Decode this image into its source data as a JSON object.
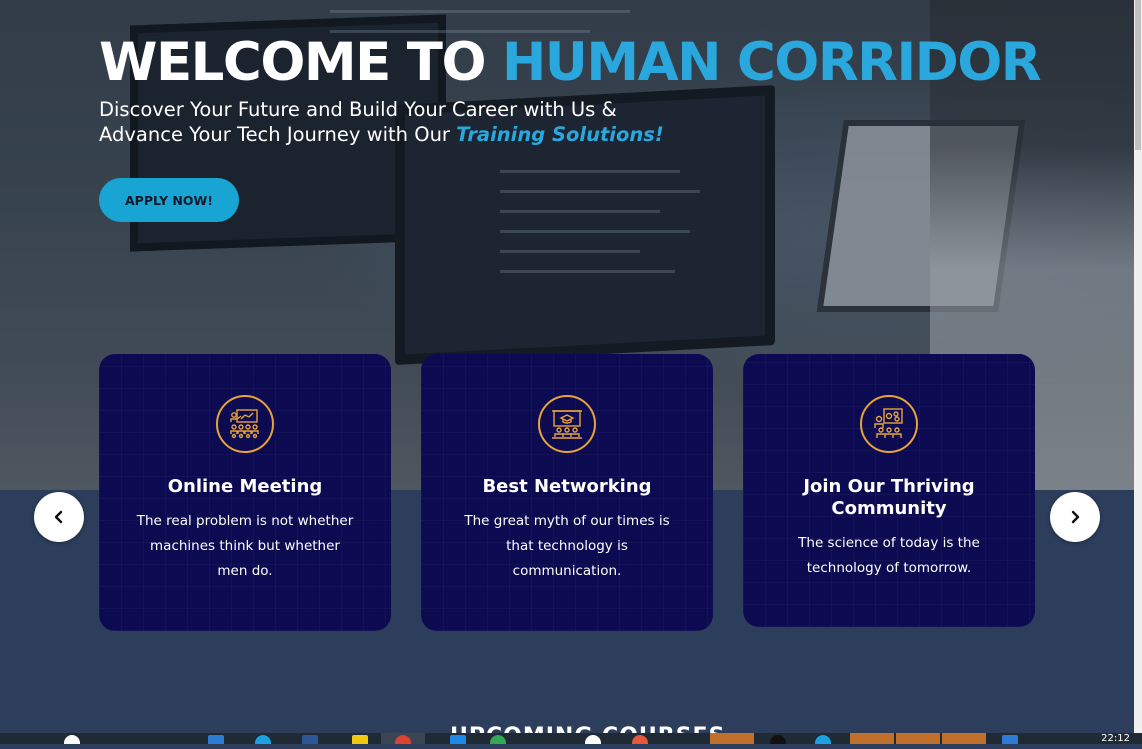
{
  "hero": {
    "title_main": "WELCOME TO ",
    "title_accent": "HUMAN CORRIDOR",
    "subtitle_line1": "Discover Your Future and Build Your Career with Us &",
    "subtitle_line2": "Advance Your Tech Journey with Our ",
    "subtitle_emphasis": "Training Solutions!",
    "apply_label": "APPLY NOW!"
  },
  "cards": [
    {
      "icon": "online-meeting-icon",
      "title": "Online Meeting",
      "text": "The real problem is not whether machines think but whether men do."
    },
    {
      "icon": "networking-presentation-icon",
      "title": "Best Networking",
      "text": "The great myth of our times is that technology is communication."
    },
    {
      "icon": "community-icon",
      "title": "Join Our Thriving Community",
      "text": "The science of today is the technology of tomorrow."
    }
  ],
  "carousel": {
    "prev_icon": "chevron-left-icon",
    "next_icon": "chevron-right-icon"
  },
  "next_section_title": "UPCOMING COURSES",
  "taskbar": {
    "clock": "22:12"
  },
  "colors": {
    "accent": "#2aa8de",
    "button": "#18a5d3",
    "card_bg": "#0c0b52",
    "icon_gold": "#e8a33a",
    "section_bg": "#2c3e5c"
  }
}
